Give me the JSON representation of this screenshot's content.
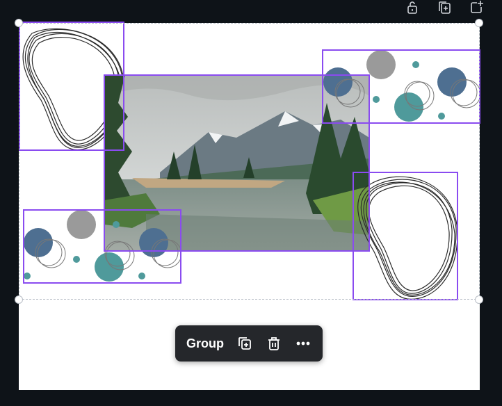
{
  "top_bar": {
    "icons": [
      "lock-icon",
      "duplicate-page-icon",
      "add-page-icon"
    ]
  },
  "toolbar": {
    "group_label": "Group",
    "icons": [
      "duplicate-icon",
      "trash-icon",
      "more-icon"
    ]
  },
  "colors": {
    "selection": "#8a4bf0",
    "canvas_bg": "#0e1318",
    "toolbar_bg": "#25272b",
    "dot_navy": "#4e6f91",
    "dot_teal": "#4f9a9b",
    "dot_gray": "#9a9a9a"
  },
  "canvas_elements": [
    {
      "name": "scribble-loop-top-left",
      "type": "decorative-scribble"
    },
    {
      "name": "dots-cluster-top-right",
      "type": "decorative-dots"
    },
    {
      "name": "mountain-lake-photo",
      "type": "photo"
    },
    {
      "name": "dots-cluster-bottom-left",
      "type": "decorative-dots"
    },
    {
      "name": "scribble-loop-bottom-right",
      "type": "decorative-scribble"
    }
  ]
}
